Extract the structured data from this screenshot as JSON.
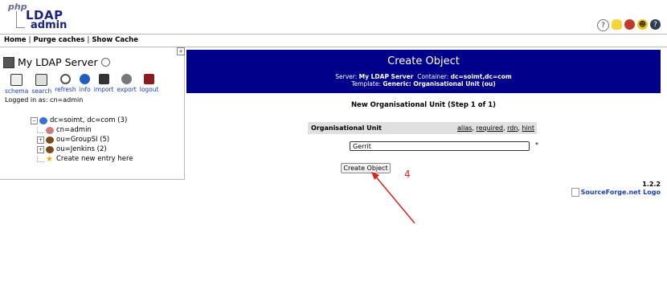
{
  "logo": {
    "php": "php",
    "ldap": "LDAP",
    "admin": "admin"
  },
  "header_icons": [
    "help-icon",
    "lightbulb-icon",
    "bug-icon",
    "smiley-icon",
    "donate-icon"
  ],
  "nav": {
    "home": "Home",
    "purge": "Purge caches",
    "show_cache": "Show Cache",
    "sep": "|"
  },
  "server": {
    "name": "My LDAP Server"
  },
  "toolbar": {
    "items": [
      {
        "label": "schema",
        "icon": "schema-icon"
      },
      {
        "label": "search",
        "icon": "search-icon"
      },
      {
        "label": "refresh",
        "icon": "refresh-icon"
      },
      {
        "label": "info",
        "icon": "info-icon"
      },
      {
        "label": "import",
        "icon": "import-icon"
      },
      {
        "label": "export",
        "icon": "export-icon"
      },
      {
        "label": "logout",
        "icon": "logout-icon"
      }
    ]
  },
  "logged_in": "Logged in as: cn=admin",
  "tree": {
    "root": "dc=soimt, dc=com (3)",
    "children": [
      {
        "label": "cn=admin",
        "icon": "user-icon"
      },
      {
        "label": "ou=GroupSI (5)",
        "icon": "ou-icon"
      },
      {
        "label": "ou=Jenkins (2)",
        "icon": "ou-icon"
      },
      {
        "label": "Create new entry here",
        "icon": "star-icon"
      }
    ]
  },
  "banner": {
    "title": "Create Object",
    "server_label": "Server:",
    "server_value": "My LDAP Server",
    "container_label": "Container:",
    "container_value": "dc=soimt,dc=com",
    "template_label": "Template:",
    "template_value": "Generic: Organisational Unit (ou)"
  },
  "step": "New Organisational Unit (Step 1 of 1)",
  "attribute": {
    "name": "Organisational Unit",
    "links": [
      "alias",
      "required",
      "rdn",
      "hint"
    ],
    "value": "Gerrit",
    "required_mark": "*"
  },
  "create_button": "Create Object",
  "annotation_number": "4",
  "footer": {
    "version": "1.2.2",
    "sf_logo": "SourceForge.net Logo"
  },
  "colors": {
    "banner_bg": "#00008b",
    "link": "#1a3cc0",
    "annotation": "#e02020"
  }
}
